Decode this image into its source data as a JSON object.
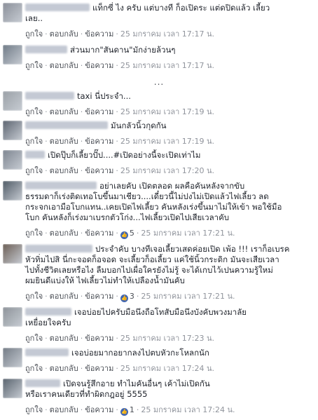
{
  "actions": {
    "like": "ถูกใจ",
    "reply": "ตอบกลับ",
    "message": "ข้อความ"
  },
  "more_indicator": "...",
  "comments": [
    {
      "name_width": 92,
      "avatar_color": "#8a8f99",
      "text": "แท็กซี่ ไง ครับ แต่บางที ก็อเปิดระ แต่ดปิดแล้ว เลี้ยว\nเลย..",
      "time": "25 มกราคม เวลา 17:17 น.",
      "likes": ""
    },
    {
      "name_width": 60,
      "avatar_color": "#6f7a86",
      "text": "ส่วนมาก\"สันดาน\"มักง่ายล้วนๆ",
      "time": "25 มกราคม เวลา 17:17 น.",
      "likes": ""
    },
    {
      "name_width": 70,
      "avatar_color": "#9aa0a6",
      "text": "taxi นี่ประจำ...",
      "time": "25 มกราคม เวลา 17:19 น.",
      "likes": ""
    },
    {
      "name_width": 118,
      "avatar_color": "#5c6470",
      "text": "มันกลัวนิ้วกุดกัน",
      "time": "25 มกราคม เวลา 17:19 น.",
      "likes": ""
    },
    {
      "name_width": 28,
      "avatar_color": "#7d8590",
      "text": "เปิดปุ๊บก็เลี้ยวปั๊ป....#เปิดอย่างนี้จะเปิดเท่าไม",
      "time": "25 มกราคม เวลา 17:20 น.",
      "likes": ""
    },
    {
      "name_width": 102,
      "avatar_color": "#4f5b66",
      "text": "อย่าเลยคับ เปิดตลอด ผลคือคันหลังจากขับ\nธรรมดาก็เร่งติดเทอโบขึ้นมาเชียว....เดี๋ยวนี้ไม่ปงไม่เปิดแล้วไฟเลี้ยว ลด\nกระจกเอามือโบกแทน..เคยเปิดไฟเลี้ยว คันหลังเร่งขึ้นมาไม่ให้เข้า พอใช้มือ\nโบก คันหลังก็เร่งมาเบรกตัวโก่ง...ไฟเลี้ยวเปิดไปเสียเวลาคับ",
      "time": "25 มกราคม เวลา 17:21 น.",
      "likes": "5"
    },
    {
      "name_width": 96,
      "avatar_color": "#6b5e55",
      "text": "ประจำคับ บางทีเจอเลี้ยวเสดค่อยเปิด เพ้อ !!! เราก็อเบรค\nหัวทิ่มไปสิ นี่กะจอดก็อจอด จะเลี้ยวก็อเลี้ยว แค่ใช้นิ้วกระดิก มันจะเสียเวลา\nไปทั้งชีวิตเลยหรือไง ลืมบอกไปเผื่อใครยังไม่รู้ จะได้เกบไว้เปนความรู้ใหม่\nผมยินดีแบ่งให้ ไฟเลี้ยวไม่ทำให้เปลืองน้ำมันคับ",
      "time": "25 มกราคม เวลา 17:21 น.",
      "likes": "3"
    },
    {
      "name_width": 66,
      "avatar_color": "#8d9399",
      "text": "เจอบ่อยไปครับมือนึงถือโทสับมือนึงบังคับพวงมาลัย\nเหยื่อยใจครับ",
      "time": "25 มกราคม เวลา 17:23 น.",
      "likes": ""
    },
    {
      "name_width": 62,
      "avatar_color": "#737b85",
      "text": "เจอบ่อยมากอยากลงไปตบหัวกะโหลกนัก",
      "time": "25 มกราคม เวลา 17:24 น.",
      "likes": ""
    },
    {
      "name_width": 50,
      "avatar_color": "#59636e",
      "text": "เปิดจนรู้สึกอาย ทำไมคันอื่นๆ เค้าไม่เปิดกัน\nหรือเราคนเดียวที่ทำผิดกฎอยู่ 5555",
      "time": "25 มกราคม เวลา 17:24 น.",
      "likes": "1"
    }
  ],
  "colors": {
    "link": "#4b4f56",
    "meta": "#90949c",
    "like_blue": "#4267b2"
  }
}
